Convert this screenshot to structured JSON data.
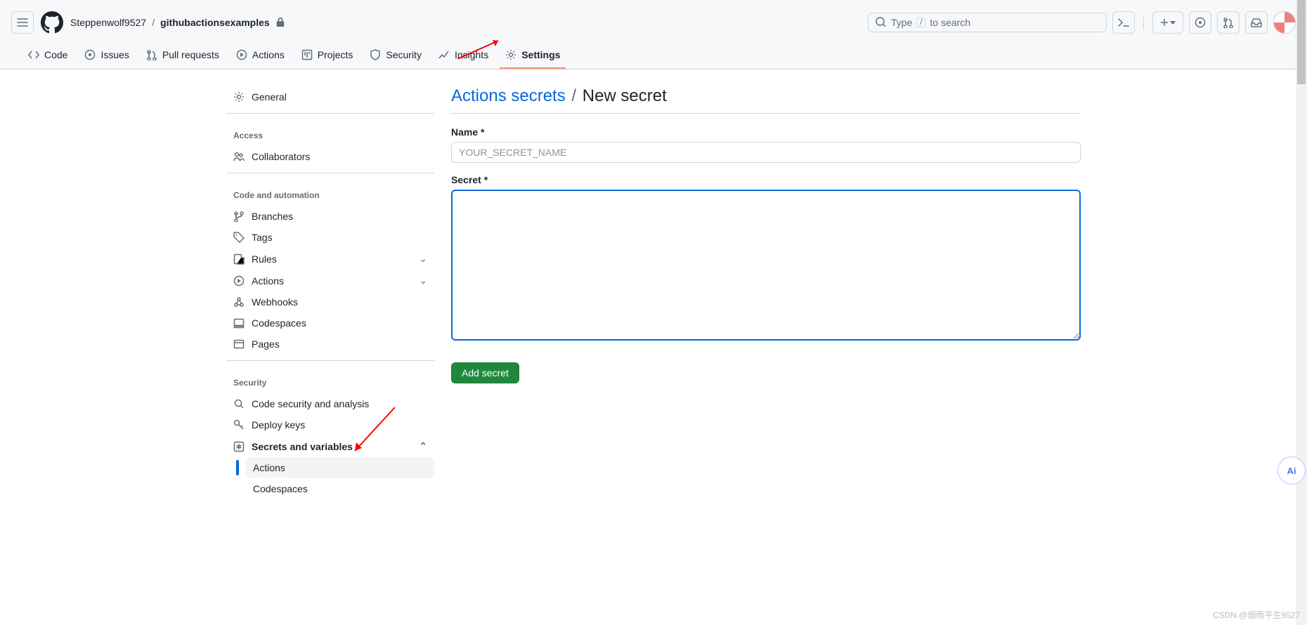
{
  "header": {
    "owner": "Steppenwolf9527",
    "repo": "githubactionsexamples",
    "search_prefix": "Type",
    "search_key": "/",
    "search_suffix": "to search"
  },
  "tabs": {
    "code": "Code",
    "issues": "Issues",
    "pulls": "Pull requests",
    "actions": "Actions",
    "projects": "Projects",
    "security": "Security",
    "insights": "Insights",
    "settings": "Settings"
  },
  "sidebar": {
    "general": "General",
    "access_title": "Access",
    "collaborators": "Collaborators",
    "code_title": "Code and automation",
    "branches": "Branches",
    "tags": "Tags",
    "rules": "Rules",
    "actions": "Actions",
    "webhooks": "Webhooks",
    "codespaces": "Codespaces",
    "pages": "Pages",
    "security_title": "Security",
    "code_security": "Code security and analysis",
    "deploy_keys": "Deploy keys",
    "secrets": "Secrets and variables",
    "sub_actions": "Actions",
    "sub_codespaces": "Codespaces"
  },
  "page": {
    "title_link": "Actions secrets",
    "title_sep": "/",
    "title_current": "New secret",
    "name_label": "Name *",
    "name_placeholder": "YOUR_SECRET_NAME",
    "secret_label": "Secret *",
    "submit": "Add secret"
  },
  "watermark": "CSDN @烟雨平生9527",
  "ai_badge": "Ai"
}
